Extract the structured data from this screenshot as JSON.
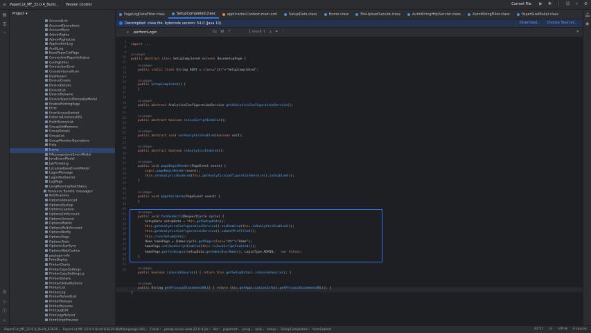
{
  "window": {
    "project": "PaperCut_MF_22.0.4_Build...",
    "vcs": "Version control",
    "run_config": "Current File"
  },
  "project_panel": {
    "title": "Project",
    "items": [
      "AccountList",
      "AccountOperations",
      "AccountSync",
      "AdminRights",
      "AdminRightsList",
      "ApplicationLog",
      "AuditLog",
      "BasePaperCutPage",
      "ConnectionReportsStatus",
      "ConfigEditor",
      "ConnectionError",
      "CreateInternalUser",
      "Dashboard",
      "DeviceCreate",
      "DeviceDetails",
      "DeviceList",
      "DeviceRename",
      "DeviceTypeListTemplateModel",
      "EnablePrintingPage",
      "Error",
      "ErrorAccessDenied",
      "ExternalLicensesURL",
      "FieldHistoryList",
      "GroupAddRemove",
      "GroupDetails",
      "GroupList",
      "GroupMemberOperations",
      "Help",
      "Home",
      "IMessagesJavaEnumModel",
      "JavaEnumModel",
      "JobTicketing",
      "LocalizedJavaEnumModel",
      "LogonMessage",
      "LogonRedirector",
      "LogPage",
      "LongRunningTaskStatus",
      "Resource Bundle 'messages'",
      "Notifications",
      "OptionsAdvanced",
      "OptionsBackup",
      "OptionsCapture",
      "OptionsExtAccount",
      "OptionsGeneral",
      "OptionsMobile",
      "OptionsMultiAccount",
      "OptionsNotify",
      "OptionsPage",
      "OptionsTools",
      "OptionsUserSync",
      "OptionsWebCashier",
      "package-info",
      "PrintDeploy",
      "PrinterCharts",
      "PrinterCopySettings",
      "PrinterCopySettings.js",
      "PrinterDetails",
      "PrinterGlobalOptions",
      "PrinterList",
      "PrinterLog",
      "PrinterRefundList",
      "PrinterRelease",
      "PrinterRename",
      "PrintLogEdit",
      "PrintLogsRefund",
      "PrintScriptPreview"
    ],
    "selected_index": 28
  },
  "tabs": [
    "PageLogDataFilter.class",
    "SetupCompleted.class",
    "applicationContext-main.xml",
    "SetupData.class",
    "Home.class",
    "FileUploadServlet.class",
    "AutoWiringHttpServlet.class",
    "AutoWiringFilter.class",
    "PaperSizeModel.class"
  ],
  "active_tab": 1,
  "banner": {
    "text": "Decompiled .class file, bytecode version: 54.0 (Java 10)",
    "download": "Download...",
    "choose": "Choose Sources..."
  },
  "search": {
    "query": "performLogin",
    "results": "1 result"
  },
  "code": {
    "import_line": "import ...",
    "class_decl": "public abstract class SetupCompleted extends BaseSetupPage {",
    "usages": "no usages",
    "lines": [
      "public static final String HINT = \"SetupCompleted\";",
      "public SetupCompleted() {",
      "}",
      "public abstract AnalyticsConfigurationService getAnalyticsConfigurationService();",
      "public abstract boolean isJavaScriptEnabled();",
      "public abstract void setAnalyticsEnabled(boolean var1);",
      "public abstract boolean isAnalyticsEnabled();",
      "public void pageBeginRender(PageEvent event) {",
      "super.pageBeginRender(event);",
      "this.setAnalyticsEnabled(this.getAnalyticsConfigurationService().isEnabled());",
      "}",
      "public void pageValidate(PageEvent event) {",
      "}",
      "public void formSubmit(IRequestCycle cycle) {",
      "SetupData setupData = this.getSetupData();",
      "this.getAnalyticsConfigurationService().setEnabled(this.isAnalyticsEnabled());",
      "this.getAnalyticsConfigurationService().submitPrefilled();",
      "this.clearSetupData();",
      "Home homePage = (Home)cycle.getPage(\"Home\");",
      "homePage.setJavaScriptEnabled(this.isJavaScriptEnabled());",
      "homePage.performLogin(setupData.getAdminUserName(), LoginType.ADMIN,   var false);",
      "}",
      "public boolean isUseJobSource() { return this.getSetupData().isUseJobSource(); }",
      "public String getPrivacyStatementURL() { return this.getApplicationInfo().getPrivacyStatementURL(); }",
      "}"
    ],
    "line_numbers": [
      "3",
      "8",
      "9",
      "10",
      "11",
      "12",
      "13",
      "14",
      "15",
      "16",
      "17",
      "18",
      "19",
      "20",
      "21",
      "22",
      "23",
      "24",
      "25",
      "26",
      "27",
      "28",
      "29",
      "30",
      "31",
      "32",
      "33",
      "34",
      "35",
      "36",
      "37",
      "38",
      "39",
      "40",
      "41",
      "42",
      "43",
      "44",
      "45",
      "46",
      "47",
      "48",
      "49",
      "50",
      "51",
      "52"
    ]
  },
  "status_bar": {
    "crumbs": [
      "PaperCut_MF_22.0.4_Build_63639",
      "PaperCut MF 22.0.4 Build 63639 Multilanguage x64",
      "Crack",
      "pmng-server-web-22.0.4.jar",
      "biz",
      "papercut",
      "pcng",
      "web",
      "setup",
      "SetupCompleted",
      "formSubmit"
    ],
    "position": "43:57",
    "line_sep": "LF",
    "encoding": "UTF-8",
    "indent": "4 spaces"
  }
}
